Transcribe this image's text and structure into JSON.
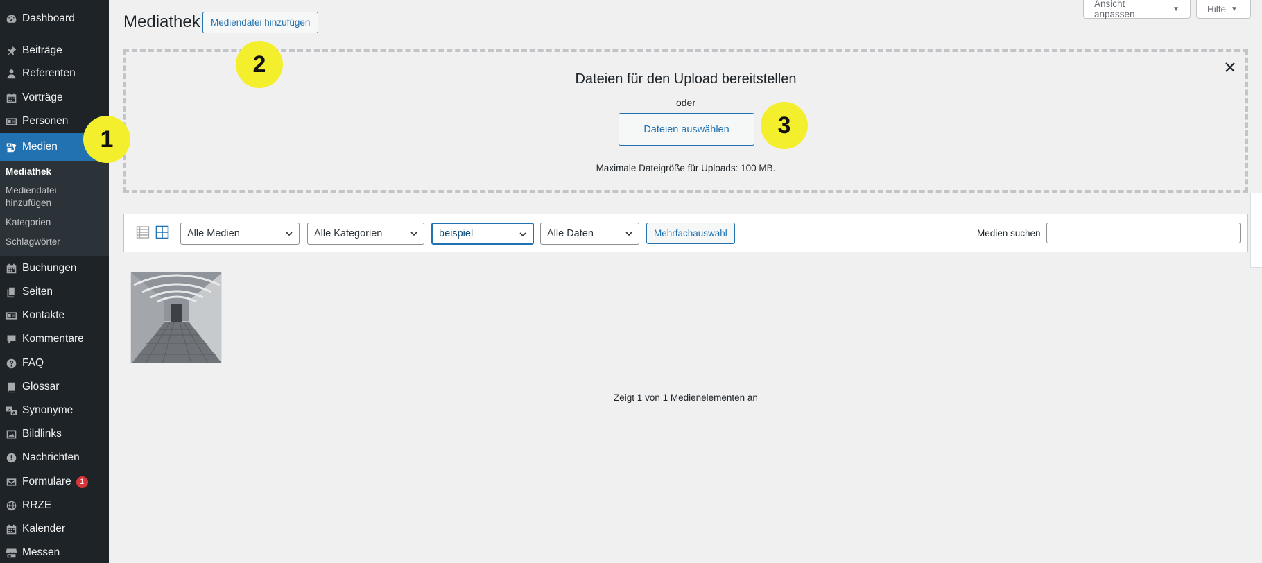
{
  "sidebar": {
    "items": [
      {
        "label": "Dashboard",
        "icon": "dashboard-icon"
      },
      {
        "label": "Beiträge",
        "icon": "pin-icon"
      },
      {
        "label": "Referenten",
        "icon": "user-icon"
      },
      {
        "label": "Vorträge",
        "icon": "calendar-icon"
      },
      {
        "label": "Personen",
        "icon": "id-card-icon"
      },
      {
        "label": "Medien",
        "icon": "media-icon",
        "active": true
      },
      {
        "label": "Buchungen",
        "icon": "calendar-icon"
      },
      {
        "label": "Seiten",
        "icon": "pages-icon"
      },
      {
        "label": "Kontakte",
        "icon": "id-card-icon"
      },
      {
        "label": "Kommentare",
        "icon": "comment-icon"
      },
      {
        "label": "FAQ",
        "icon": "help-icon"
      },
      {
        "label": "Glossar",
        "icon": "book-icon"
      },
      {
        "label": "Synonyme",
        "icon": "translation-icon"
      },
      {
        "label": "Bildlinks",
        "icon": "image-icon"
      },
      {
        "label": "Nachrichten",
        "icon": "alert-icon"
      },
      {
        "label": "Formulare",
        "icon": "email-icon",
        "badge": "1"
      },
      {
        "label": "RRZE",
        "icon": "globe-icon"
      },
      {
        "label": "Kalender",
        "icon": "calendar-icon"
      },
      {
        "label": "Messen",
        "icon": "store-icon"
      }
    ],
    "submenu": [
      {
        "label": "Mediathek",
        "current": true
      },
      {
        "label": "Mediendatei hinzufügen"
      },
      {
        "label": "Kategorien"
      },
      {
        "label": "Schlagwörter"
      }
    ]
  },
  "header": {
    "title": "Mediathek",
    "add_label": "Mediendatei hinzufügen",
    "screen_options": "Ansicht anpassen",
    "help": "Hilfe"
  },
  "upload": {
    "title": "Dateien für den Upload bereitstellen",
    "or": "oder",
    "select_label": "Dateien auswählen",
    "max_size": "Maximale Dateigröße für Uploads: 100 MB."
  },
  "toolbar": {
    "filters": [
      "Alle Medien",
      "Alle Kategorien",
      "beispiel",
      "Alle Daten"
    ],
    "multi_select": "Mehrfachauswahl",
    "search_label": "Medien suchen",
    "search_value": ""
  },
  "status": {
    "count_text": "Zeigt 1 von 1 Medienelementen an"
  },
  "callouts": [
    "1",
    "2",
    "3"
  ],
  "colors": {
    "sidebar_bg": "#1d2327",
    "accent": "#2271b1",
    "callout": "#f3ef2c",
    "badge": "#d63638"
  }
}
